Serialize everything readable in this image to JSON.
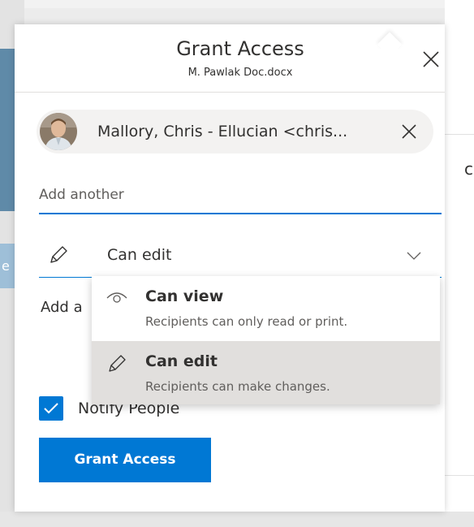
{
  "dialog": {
    "title": "Grant Access",
    "subtitle": "M. Pawlak Doc.docx"
  },
  "recipient": {
    "display": "Mallory, Chris - Ellucian <chris..."
  },
  "add_input": {
    "placeholder": "Add another"
  },
  "permission": {
    "selected": "Can edit"
  },
  "add_message": {
    "label": "Add a"
  },
  "notify": {
    "label": "Notify People",
    "checked": true
  },
  "grant_button": {
    "label": "Grant Access"
  },
  "menu": {
    "items": [
      {
        "title": "Can view",
        "desc": "Recipients can only read or print.",
        "icon": "eye-icon",
        "selected": false
      },
      {
        "title": "Can edit",
        "desc": "Recipients can make changes.",
        "icon": "pencil-icon",
        "selected": true
      }
    ]
  },
  "background": {
    "right_char": "c",
    "left_char": "e"
  },
  "colors": {
    "accent": "#0078d4",
    "selected_row": "#e1dfdd",
    "chip": "#f3f2f1"
  }
}
